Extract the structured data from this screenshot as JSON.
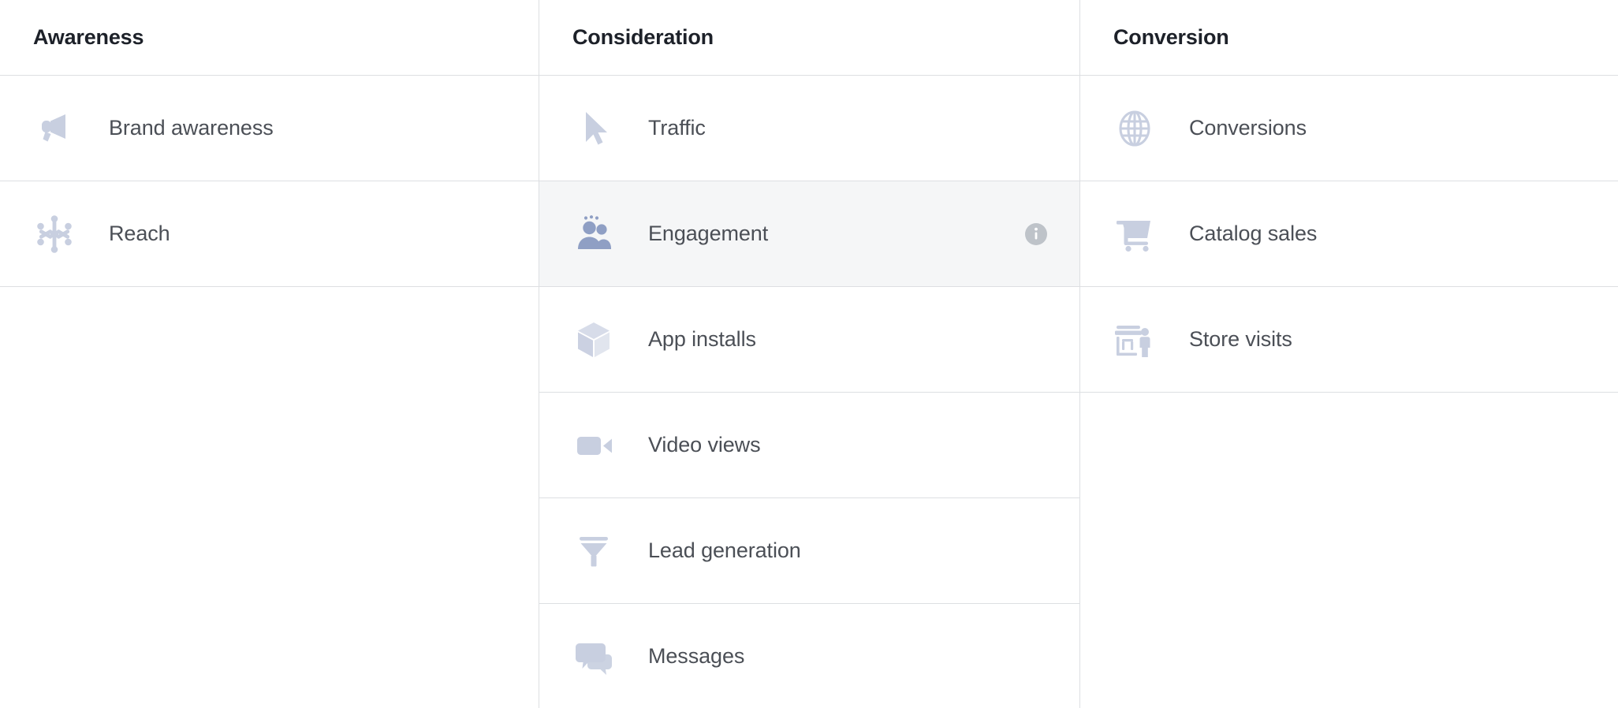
{
  "colors": {
    "icon_default": "#c8cfe0",
    "icon_selected": "#8f9fc4",
    "text_label": "#4b4f56",
    "text_header": "#1d2129",
    "border": "#dddfe2",
    "row_selected_bg": "#f5f6f7",
    "info_icon_bg": "#bec3c9",
    "page_bg": "#ffffff"
  },
  "columns": [
    {
      "key": "awareness",
      "header": "Awareness",
      "items": [
        {
          "label": "Brand awareness",
          "icon": "megaphone-icon",
          "selected": false,
          "has_info": false
        },
        {
          "label": "Reach",
          "icon": "reach-burst-icon",
          "selected": false,
          "has_info": false
        }
      ]
    },
    {
      "key": "consideration",
      "header": "Consideration",
      "items": [
        {
          "label": "Traffic",
          "icon": "cursor-arrow-icon",
          "selected": false,
          "has_info": false
        },
        {
          "label": "Engagement",
          "icon": "people-group-icon",
          "selected": true,
          "has_info": true
        },
        {
          "label": "App installs",
          "icon": "cube-box-icon",
          "selected": false,
          "has_info": false
        },
        {
          "label": "Video views",
          "icon": "video-camera-icon",
          "selected": false,
          "has_info": false
        },
        {
          "label": "Lead generation",
          "icon": "funnel-icon",
          "selected": false,
          "has_info": false
        },
        {
          "label": "Messages",
          "icon": "chat-bubbles-icon",
          "selected": false,
          "has_info": false
        }
      ]
    },
    {
      "key": "conversion",
      "header": "Conversion",
      "items": [
        {
          "label": "Conversions",
          "icon": "globe-icon",
          "selected": false,
          "has_info": false
        },
        {
          "label": "Catalog sales",
          "icon": "shopping-cart-icon",
          "selected": false,
          "has_info": false
        },
        {
          "label": "Store visits",
          "icon": "storefront-person-icon",
          "selected": false,
          "has_info": false
        }
      ]
    }
  ],
  "info_tooltip_label": "i"
}
